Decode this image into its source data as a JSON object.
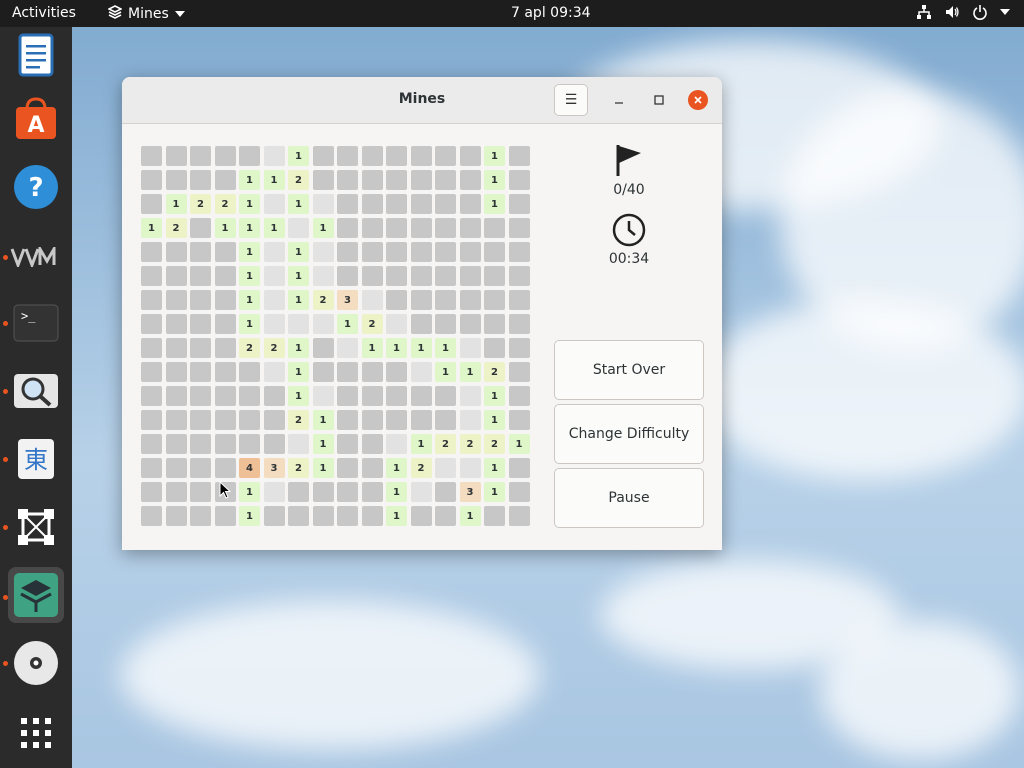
{
  "topbar": {
    "activities": "Activities",
    "app_name": "Mines",
    "clock": "7 apl  09:34"
  },
  "dock": {
    "items": [
      {
        "name": "text-editor-icon"
      },
      {
        "name": "software-center-icon"
      },
      {
        "name": "help-icon"
      },
      {
        "name": "vmware-icon"
      },
      {
        "name": "terminal-icon"
      },
      {
        "name": "search-tool-icon"
      },
      {
        "name": "character-map-icon"
      },
      {
        "name": "vector-editor-icon"
      },
      {
        "name": "mines-app-icon"
      },
      {
        "name": "disc-icon"
      },
      {
        "name": "show-apps-icon"
      }
    ]
  },
  "window": {
    "title": "Mines",
    "flags": "0/40",
    "time": "00:34",
    "buttons": {
      "start_over": "Start Over",
      "change_difficulty": "Change Difficulty",
      "pause": "Pause"
    }
  },
  "board": {
    "rows": [
      "......1.......1.",
      "....112.......1.",
      ".1221.1.......1.",
      "12.111.1........",
      "....1.1.........",
      "....1.1.........",
      "....1.123.......",
      "....1...12......",
      "....221..1111...",
      "......1.....112.",
      "......1.......1.",
      "......21......1.",
      ".......1...12221",
      "....4321..12..1.",
      "....1.....1..31.",
      "....1.....1..1.."
    ],
    "legend": ". = covered or empty cell; digits = adjacent mine count"
  }
}
